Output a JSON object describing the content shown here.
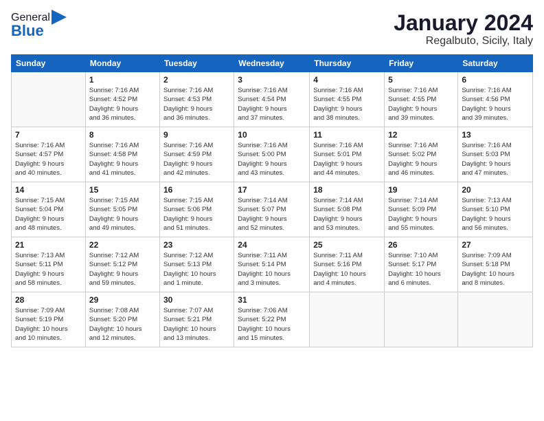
{
  "header": {
    "logo_general": "General",
    "logo_blue": "Blue",
    "month_title": "January 2024",
    "subtitle": "Regalbuto, Sicily, Italy"
  },
  "columns": [
    "Sunday",
    "Monday",
    "Tuesday",
    "Wednesday",
    "Thursday",
    "Friday",
    "Saturday"
  ],
  "weeks": [
    [
      {
        "day": "",
        "info": ""
      },
      {
        "day": "1",
        "info": "Sunrise: 7:16 AM\nSunset: 4:52 PM\nDaylight: 9 hours\nand 36 minutes."
      },
      {
        "day": "2",
        "info": "Sunrise: 7:16 AM\nSunset: 4:53 PM\nDaylight: 9 hours\nand 36 minutes."
      },
      {
        "day": "3",
        "info": "Sunrise: 7:16 AM\nSunset: 4:54 PM\nDaylight: 9 hours\nand 37 minutes."
      },
      {
        "day": "4",
        "info": "Sunrise: 7:16 AM\nSunset: 4:55 PM\nDaylight: 9 hours\nand 38 minutes."
      },
      {
        "day": "5",
        "info": "Sunrise: 7:16 AM\nSunset: 4:55 PM\nDaylight: 9 hours\nand 39 minutes."
      },
      {
        "day": "6",
        "info": "Sunrise: 7:16 AM\nSunset: 4:56 PM\nDaylight: 9 hours\nand 39 minutes."
      }
    ],
    [
      {
        "day": "7",
        "info": "Sunrise: 7:16 AM\nSunset: 4:57 PM\nDaylight: 9 hours\nand 40 minutes."
      },
      {
        "day": "8",
        "info": "Sunrise: 7:16 AM\nSunset: 4:58 PM\nDaylight: 9 hours\nand 41 minutes."
      },
      {
        "day": "9",
        "info": "Sunrise: 7:16 AM\nSunset: 4:59 PM\nDaylight: 9 hours\nand 42 minutes."
      },
      {
        "day": "10",
        "info": "Sunrise: 7:16 AM\nSunset: 5:00 PM\nDaylight: 9 hours\nand 43 minutes."
      },
      {
        "day": "11",
        "info": "Sunrise: 7:16 AM\nSunset: 5:01 PM\nDaylight: 9 hours\nand 44 minutes."
      },
      {
        "day": "12",
        "info": "Sunrise: 7:16 AM\nSunset: 5:02 PM\nDaylight: 9 hours\nand 46 minutes."
      },
      {
        "day": "13",
        "info": "Sunrise: 7:16 AM\nSunset: 5:03 PM\nDaylight: 9 hours\nand 47 minutes."
      }
    ],
    [
      {
        "day": "14",
        "info": "Sunrise: 7:15 AM\nSunset: 5:04 PM\nDaylight: 9 hours\nand 48 minutes."
      },
      {
        "day": "15",
        "info": "Sunrise: 7:15 AM\nSunset: 5:05 PM\nDaylight: 9 hours\nand 49 minutes."
      },
      {
        "day": "16",
        "info": "Sunrise: 7:15 AM\nSunset: 5:06 PM\nDaylight: 9 hours\nand 51 minutes."
      },
      {
        "day": "17",
        "info": "Sunrise: 7:14 AM\nSunset: 5:07 PM\nDaylight: 9 hours\nand 52 minutes."
      },
      {
        "day": "18",
        "info": "Sunrise: 7:14 AM\nSunset: 5:08 PM\nDaylight: 9 hours\nand 53 minutes."
      },
      {
        "day": "19",
        "info": "Sunrise: 7:14 AM\nSunset: 5:09 PM\nDaylight: 9 hours\nand 55 minutes."
      },
      {
        "day": "20",
        "info": "Sunrise: 7:13 AM\nSunset: 5:10 PM\nDaylight: 9 hours\nand 56 minutes."
      }
    ],
    [
      {
        "day": "21",
        "info": "Sunrise: 7:13 AM\nSunset: 5:11 PM\nDaylight: 9 hours\nand 58 minutes."
      },
      {
        "day": "22",
        "info": "Sunrise: 7:12 AM\nSunset: 5:12 PM\nDaylight: 9 hours\nand 59 minutes."
      },
      {
        "day": "23",
        "info": "Sunrise: 7:12 AM\nSunset: 5:13 PM\nDaylight: 10 hours\nand 1 minute."
      },
      {
        "day": "24",
        "info": "Sunrise: 7:11 AM\nSunset: 5:14 PM\nDaylight: 10 hours\nand 3 minutes."
      },
      {
        "day": "25",
        "info": "Sunrise: 7:11 AM\nSunset: 5:16 PM\nDaylight: 10 hours\nand 4 minutes."
      },
      {
        "day": "26",
        "info": "Sunrise: 7:10 AM\nSunset: 5:17 PM\nDaylight: 10 hours\nand 6 minutes."
      },
      {
        "day": "27",
        "info": "Sunrise: 7:09 AM\nSunset: 5:18 PM\nDaylight: 10 hours\nand 8 minutes."
      }
    ],
    [
      {
        "day": "28",
        "info": "Sunrise: 7:09 AM\nSunset: 5:19 PM\nDaylight: 10 hours\nand 10 minutes."
      },
      {
        "day": "29",
        "info": "Sunrise: 7:08 AM\nSunset: 5:20 PM\nDaylight: 10 hours\nand 12 minutes."
      },
      {
        "day": "30",
        "info": "Sunrise: 7:07 AM\nSunset: 5:21 PM\nDaylight: 10 hours\nand 13 minutes."
      },
      {
        "day": "31",
        "info": "Sunrise: 7:06 AM\nSunset: 5:22 PM\nDaylight: 10 hours\nand 15 minutes."
      },
      {
        "day": "",
        "info": ""
      },
      {
        "day": "",
        "info": ""
      },
      {
        "day": "",
        "info": ""
      }
    ]
  ]
}
